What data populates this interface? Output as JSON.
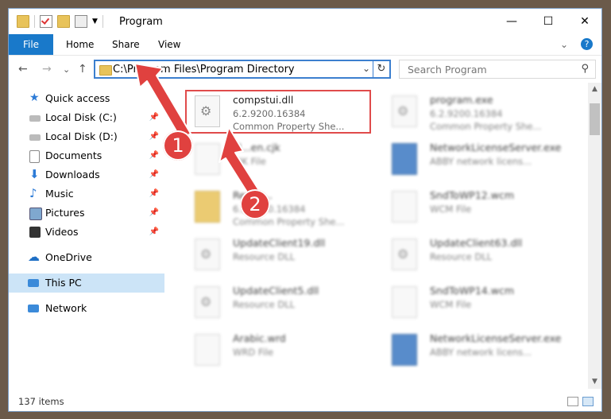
{
  "window": {
    "title": "Program",
    "controls": {
      "minimize": "—",
      "maximize": "☐",
      "close": "✕"
    }
  },
  "ribbon": {
    "tabs": [
      "File",
      "Home",
      "Share",
      "View"
    ],
    "collapse": "⌄",
    "help": "?"
  },
  "navbar": {
    "back": "←",
    "forward": "→",
    "recent": "⌄",
    "up": "↑",
    "address": "C:\\Program Files\\Program Directory",
    "dropdown": "⌄",
    "refresh": "↻",
    "search_placeholder": "Search Program",
    "search_icon": "search-icon"
  },
  "sidebar": {
    "items": [
      {
        "label": "Quick access",
        "icon": "star-icon",
        "pinned": false
      },
      {
        "label": "Local Disk (C:)",
        "icon": "drive-icon",
        "pinned": true
      },
      {
        "label": "Local Disk (D:)",
        "icon": "drive-icon",
        "pinned": true
      },
      {
        "label": "Documents",
        "icon": "documents-icon",
        "pinned": true
      },
      {
        "label": "Downloads",
        "icon": "downloads-icon",
        "pinned": true
      },
      {
        "label": "Music",
        "icon": "music-icon",
        "pinned": true
      },
      {
        "label": "Pictures",
        "icon": "pictures-icon",
        "pinned": true
      },
      {
        "label": "Videos",
        "icon": "videos-icon",
        "pinned": true
      },
      {
        "label": "OneDrive",
        "icon": "cloud-icon",
        "pinned": false
      },
      {
        "label": "This PC",
        "icon": "computer-icon",
        "pinned": false,
        "selected": true
      },
      {
        "label": "Network",
        "icon": "network-icon",
        "pinned": false
      }
    ]
  },
  "files": [
    {
      "name": "compstui.dll",
      "l2": "6.2.9200.16384",
      "l3": "Common Property She...",
      "icon": "dll-gear-icon",
      "blurred": false
    },
    {
      "name": "program.exe",
      "l2": "6.2.9200.16384",
      "l3": "Common Property She...",
      "icon": "exe-icon",
      "blurred": true
    },
    {
      "name": "kl...en.cjk",
      "l2": "CJK File",
      "l3": "",
      "icon": "file-icon",
      "blurred": true
    },
    {
      "name": "NetworkLicenseServer.exe",
      "l2": "ABBY network licens...",
      "l3": "",
      "icon": "app-icon",
      "blurred": true
    },
    {
      "name": "Resou...",
      "l2": "6.2.9200.16384",
      "l3": "Common Property She...",
      "icon": "folder-icon",
      "blurred": true
    },
    {
      "name": "SndToWP12.wcm",
      "l2": "WCM File",
      "l3": "",
      "icon": "file-icon",
      "blurred": true
    },
    {
      "name": "UpdateClient19.dll",
      "l2": "Resource DLL",
      "l3": "",
      "icon": "dll-gear-icon",
      "blurred": true
    },
    {
      "name": "UpdateClient63.dll",
      "l2": "Resource DLL",
      "l3": "",
      "icon": "dll-gear-icon",
      "blurred": true
    },
    {
      "name": "UpdateClient5.dll",
      "l2": "Resource DLL",
      "l3": "",
      "icon": "dll-gear-icon",
      "blurred": true
    },
    {
      "name": "SndToWP14.wcm",
      "l2": "WCM File",
      "l3": "",
      "icon": "file-icon",
      "blurred": true
    },
    {
      "name": "Arabic.wrd",
      "l2": "WRD File",
      "l3": "",
      "icon": "file-icon",
      "blurred": true
    },
    {
      "name": "NetworkLicenseServer.exe",
      "l2": "ABBY network licens...",
      "l3": "",
      "icon": "app-icon",
      "blurred": true
    }
  ],
  "status": {
    "count": "137 items"
  },
  "annotations": {
    "badge1": "1",
    "badge2": "2",
    "color": "#e0413f"
  }
}
